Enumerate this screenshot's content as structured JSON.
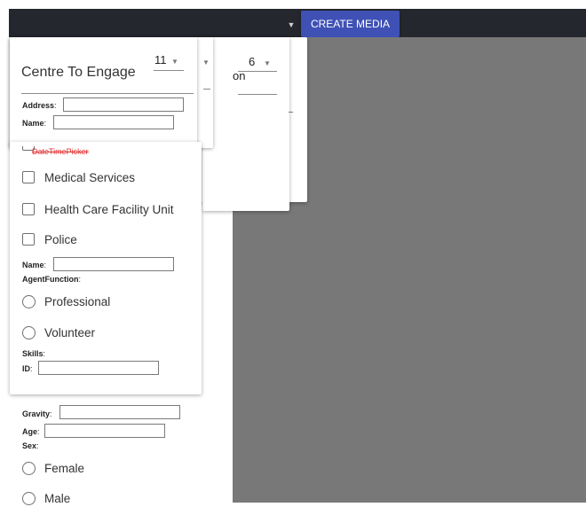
{
  "toolbar": {
    "create_media_label": "CREATE MEDIA",
    "caret_glyph": "▼"
  },
  "back_panel": {
    "select_value": "6",
    "partial_text": "on"
  },
  "front_panel": {
    "title": "Centre To Engage",
    "select_value": "11",
    "address_label": "Address",
    "name_label": "Name",
    "address_value": "",
    "name_value": ""
  },
  "form": {
    "datetime_picker_text": "DateTimePicker",
    "services": [
      {
        "label": "Medical Services",
        "checked": false
      },
      {
        "label": "Health Care Facility Unit",
        "checked": false
      },
      {
        "label": "Police",
        "checked": false
      }
    ],
    "agent_name_label": "Name",
    "agent_function_label": "AgentFunction",
    "agent_functions": [
      {
        "label": "Professional",
        "selected": false
      },
      {
        "label": "Volunteer",
        "selected": false
      }
    ],
    "skills_label": "Skills",
    "id_label": "ID",
    "gravity_label": "Gravity",
    "age_label": "Age",
    "sex_label": "Sex",
    "sex_options": [
      {
        "label": "Female",
        "selected": false
      },
      {
        "label": "Male",
        "selected": false
      }
    ],
    "colon": ":"
  },
  "colors": {
    "topbar": "#25272e",
    "accent": "#3f51b5",
    "backdrop": "#787878",
    "error_text": "#e02d2d"
  }
}
